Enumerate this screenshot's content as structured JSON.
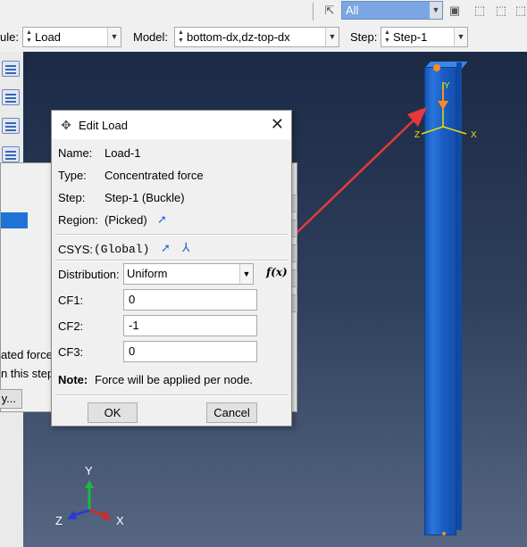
{
  "toolbar": {
    "selection_filter": "All"
  },
  "context": {
    "module_label": "ule:",
    "module_value": "Load",
    "model_label": "Model:",
    "model_value": "bottom-dx,dz-top-dx",
    "step_label": "Step:",
    "step_value": "Step-1"
  },
  "background_dialog": {
    "line1": "ated force",
    "line2": "n this step",
    "button": "y..."
  },
  "dialog": {
    "title": "Edit Load",
    "name_label": "Name:",
    "name_value": "Load-1",
    "type_label": "Type:",
    "type_value": "Concentrated force",
    "step_label": "Step:",
    "step_value": "Step-1 (Buckle)",
    "region_label": "Region:",
    "region_value": "(Picked)",
    "csys_label": "CSYS:",
    "csys_value": "(Global)",
    "distribution_label": "Distribution:",
    "distribution_value": "Uniform",
    "fx_label": "f(x)",
    "cf1_label": "CF1:",
    "cf1_value": "0",
    "cf2_label": "CF2:",
    "cf2_value": "-1",
    "cf3_label": "CF3:",
    "cf3_value": "0",
    "note_label": "Note:",
    "note_text": "Force will be applied per node.",
    "ok_label": "OK",
    "cancel_label": "Cancel"
  },
  "viewport": {
    "triad_y": "Y",
    "triad_x": "X",
    "triad_z": "Z",
    "local_y": "Y",
    "local_x": "X",
    "local_z": "Z",
    "arrow_color": "#e8383a"
  }
}
